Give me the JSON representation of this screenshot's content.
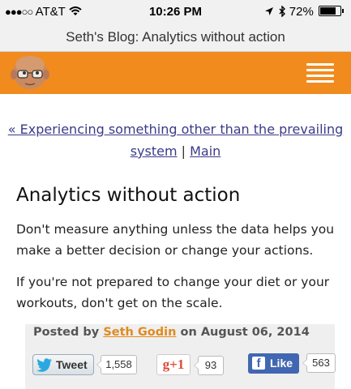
{
  "status_bar": {
    "carrier": "AT&T",
    "time": "10:26 PM",
    "battery": "72%"
  },
  "browser": {
    "page_title": "Seth's Blog: Analytics without action"
  },
  "nav": {
    "prev_post": "« Experiencing something other than the prevailing system",
    "separator": "|",
    "main": "Main"
  },
  "post": {
    "title": "Analytics without action",
    "paragraphs": [
      "Don't measure anything unless the data helps you make a better decision or change your actions.",
      "If you're not prepared to change your diet or your workouts, don't get on the scale."
    ]
  },
  "footer": {
    "posted_by_prefix": "Posted by",
    "author": "Seth Godin",
    "on_text": "on August 06, 2014"
  },
  "social": {
    "tweet_label": "Tweet",
    "tweet_count": "1,558",
    "gplus_label": "g+1",
    "gplus_count": "93",
    "fb_label": "Like",
    "fb_count": "563"
  },
  "colors": {
    "header_orange": "#f18b1e",
    "link": "#3a3a8a",
    "author_link": "#e08a1e",
    "facebook_blue": "#4267b2",
    "gplus_red": "#dd4b39"
  }
}
